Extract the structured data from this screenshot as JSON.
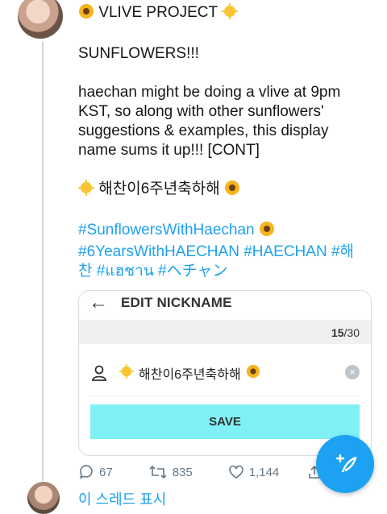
{
  "tweet": {
    "header_text": "VLIVE PROJECT",
    "line_sunflowers": "SUNFLOWERS!!!",
    "body_lines": [
      "haechan might be doing a vlive at 9pm",
      "KST, so along with other sunflowers'",
      "suggestions & examples, this display",
      "name sums it up!!! [CONT]"
    ],
    "display_name_text": "해찬이6주년축하해",
    "hashtags_line1": "#SunflowersWithHaechan",
    "hashtags_line2": "#6YearsWithHAECHAN  #HAECHAN #해",
    "hashtags_line3": "찬 #แฮชาน #ヘチャン"
  },
  "card": {
    "title": "EDIT NICKNAME",
    "counter_current": "15",
    "counter_max": "/30",
    "nickname_value": "해찬이6주년축하해",
    "save_label": "SAVE"
  },
  "actions": {
    "replies": "67",
    "retweets": "835",
    "likes": "1,144"
  },
  "thread": {
    "show_thread_label": "이 스레드 표시"
  },
  "icons": {
    "sun": "sun-emoji",
    "sunflower": "sunflower-emoji",
    "compose": "compose-icon",
    "reply": "reply-icon",
    "retweet": "retweet-icon",
    "like": "heart-icon",
    "share": "share-icon",
    "user": "user-icon",
    "clear": "clear-icon",
    "back": "back-arrow-icon"
  },
  "colors": {
    "link": "#1da1f2",
    "save_button": "#7ef0f6"
  }
}
